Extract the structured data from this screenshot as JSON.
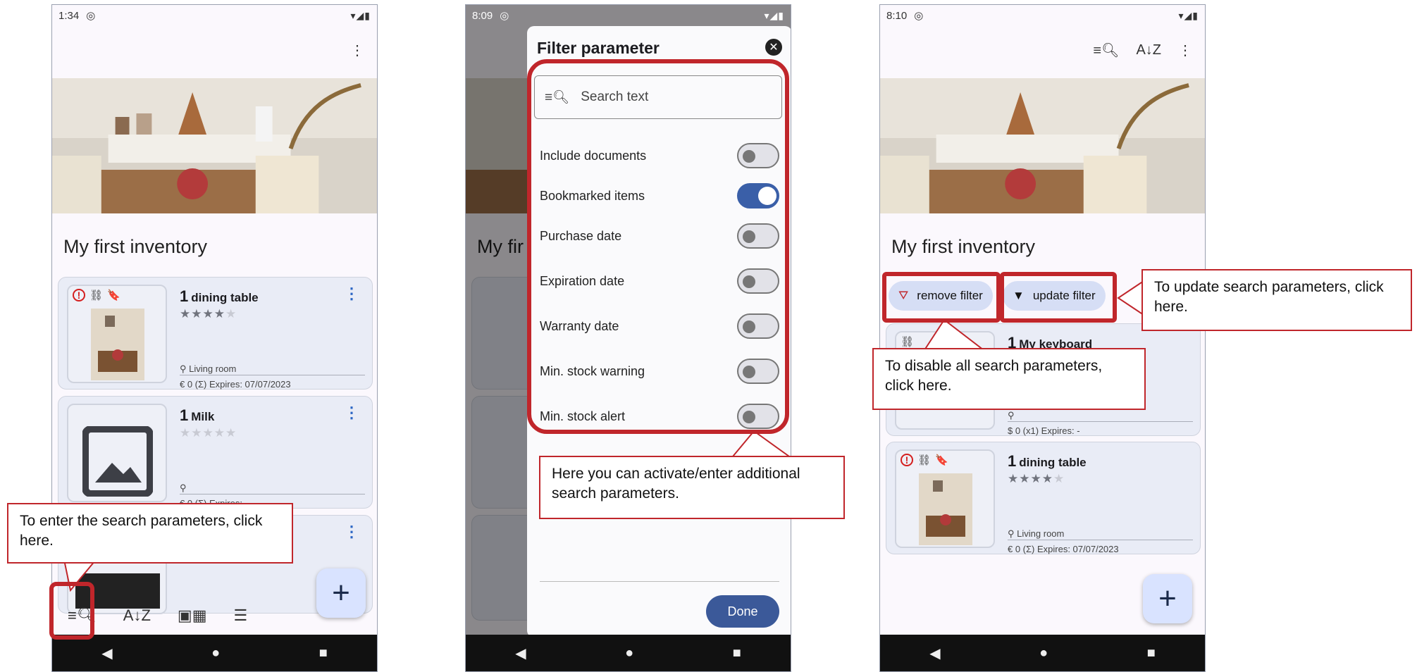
{
  "phone1": {
    "status_time": "1:34",
    "status_icons": "▾◢▮",
    "inventory_title": "My first inventory",
    "items": [
      {
        "qty": "1",
        "name": "dining table",
        "location": "Living room",
        "footer": "€ 0   (Σ)   Expires: 07/07/2023",
        "rating": 4
      },
      {
        "qty": "1",
        "name": "Milk",
        "location": "",
        "footer": "€ 0   (Σ)   Expires: -",
        "rating": 0
      }
    ],
    "callout": "To enter the search parameters, click here."
  },
  "phone2": {
    "status_time": "8:09",
    "status_icons": "▾◢▮",
    "bg_title": "My fir",
    "dialog": {
      "title": "Filter parameter",
      "search_placeholder": "Search text",
      "toggles": [
        {
          "label": "Include documents",
          "on": false
        },
        {
          "label": "Bookmarked items",
          "on": true
        },
        {
          "label": "Purchase date",
          "on": false
        },
        {
          "label": "Expiration date",
          "on": false
        },
        {
          "label": "Warranty date",
          "on": false
        },
        {
          "label": "Min. stock warning",
          "on": false
        },
        {
          "label": "Min. stock alert",
          "on": false
        }
      ],
      "done_label": "Done"
    },
    "callout": "Here you can activate/enter additional search parameters."
  },
  "phone3": {
    "status_time": "8:10",
    "status_icons": "▾◢▮",
    "inventory_title": "My first inventory",
    "remove_filter": "remove filter",
    "update_filter": "update filter",
    "items": [
      {
        "qty": "1",
        "name": "My keyboard",
        "location": "",
        "footer": "$ 0   (x1)   Expires: -"
      },
      {
        "qty": "1",
        "name": "dining table",
        "location": "Living room",
        "footer": "€ 0   (Σ)   Expires: 07/07/2023",
        "rating": 4
      }
    ],
    "callout_disable": "To disable all search parameters, click here.",
    "callout_update": "To update search parameters, click here."
  },
  "colors": {
    "accent": "#c0262b",
    "chip": "#d6def5",
    "toggle_on": "#3a5fa8",
    "card": "#e9ecf6"
  },
  "icons": [
    "more-vert-icon",
    "search-list-icon",
    "sort-az-icon",
    "grid-view-icon",
    "list-view-icon",
    "add-icon",
    "bookmark-icon",
    "link-icon",
    "warning-icon",
    "location-pin-icon",
    "close-icon",
    "filter-off-icon",
    "filter-icon",
    "back-nav-icon",
    "home-nav-icon",
    "recents-nav-icon"
  ]
}
